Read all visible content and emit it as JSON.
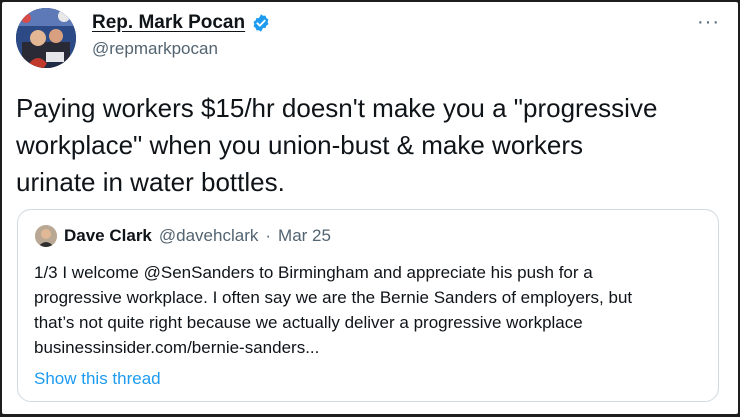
{
  "author": {
    "display_name": "Rep. Mark Pocan",
    "handle": "@repmarkpocan",
    "verified_icon": "verified-badge-icon",
    "avatar_icon": "profile-photo"
  },
  "more_icon": "more-options-icon",
  "more_label": "···",
  "tweet": {
    "lines": [
      "Paying workers $15/hr doesn't make you a \"progressive",
      "workplace\" when you union-bust & make workers",
      "urinate in water bottles."
    ]
  },
  "quoted_tweet": {
    "display_name": "Dave Clark",
    "handle": "@davehclark",
    "separator": "·",
    "date": "Mar 25",
    "lines": [
      "1/3 I welcome @SenSanders to Birmingham and appreciate his push for a",
      "progressive workplace. I often say we are the Bernie Sanders of employers, but",
      "that’s not quite right because we actually deliver a progressive workplace",
      "businessinsider.com/bernie-sanders..."
    ],
    "show_thread_label": "Show this thread"
  },
  "colors": {
    "text": "#0f1419",
    "secondary": "#536471",
    "link": "#1d9bf0",
    "verified": "#1d9bf0",
    "border": "#cfd9de",
    "outer_frame": "#1e1e1e"
  }
}
